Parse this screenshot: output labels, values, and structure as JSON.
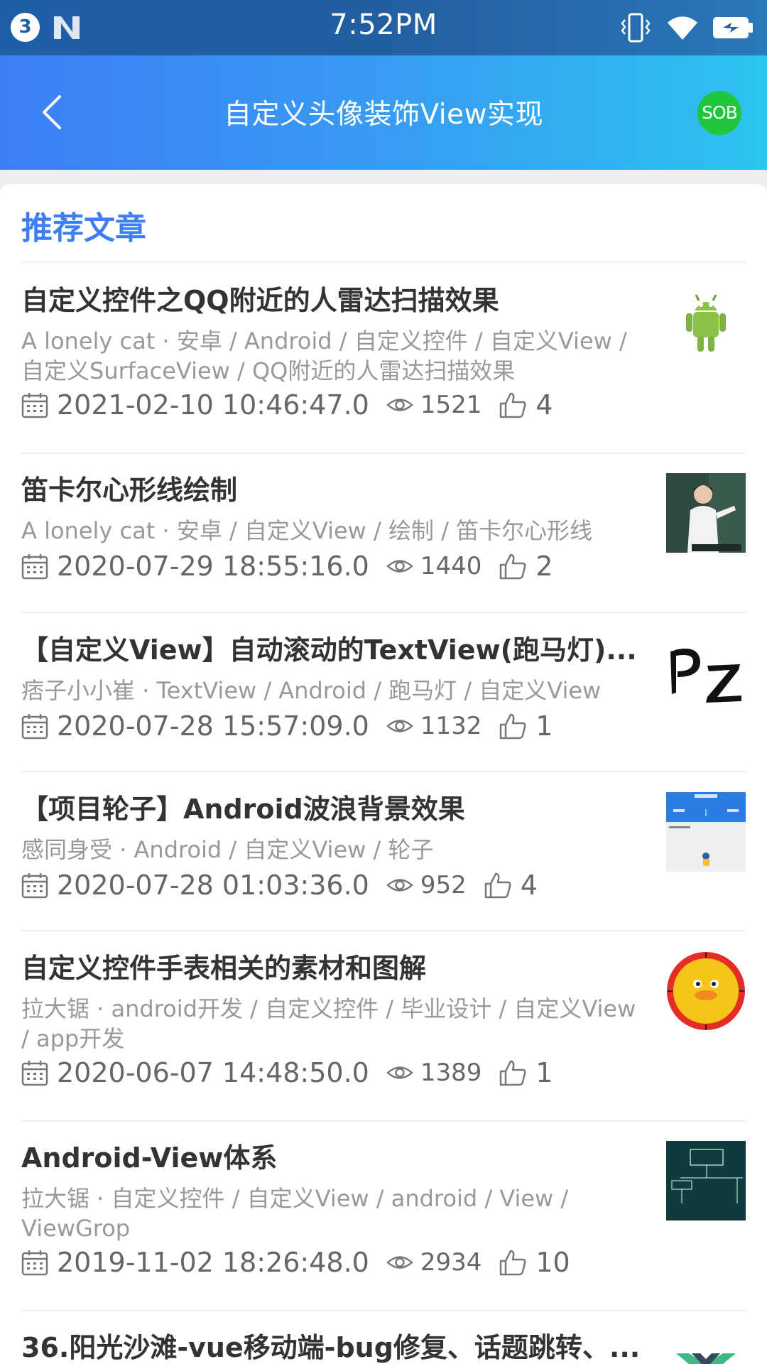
{
  "status_bar": {
    "notification_count": "3",
    "time": "7:52PM",
    "icons": [
      "n-icon",
      "vibrate-icon",
      "wifi-icon",
      "battery-charging-icon"
    ]
  },
  "app_bar": {
    "title": "自定义头像装饰View实现",
    "avatar_text": "SOB",
    "avatar_color": "#20c63c"
  },
  "section": {
    "title": "推荐文章"
  },
  "articles": [
    {
      "title": "自定义控件之QQ附近的人雷达扫描效果",
      "meta": "A lonely cat · 安卓 / Android / 自定义控件 / 自定义View / 自定义SurfaceView / QQ附近的人雷达扫描效果",
      "date": "2021-02-10 10:46:47.0",
      "views": "1521",
      "likes": "4",
      "thumb": "android-robot"
    },
    {
      "title": "笛卡尔心形线绘制",
      "meta": "A lonely cat · 安卓 / 自定义View / 绘制 / 笛卡尔心形线",
      "date": "2020-07-29 18:55:16.0",
      "views": "1440",
      "likes": "2",
      "thumb": "person-photo"
    },
    {
      "title": "【自定义View】自动滚动的TextView(跑马灯)...",
      "meta": "痞子小小崔 · TextView / Android / 跑马灯 / 自定义View",
      "date": "2020-07-28 15:57:09.0",
      "views": "1132",
      "likes": "1",
      "thumb": "pz-logo"
    },
    {
      "title": "【项目轮子】Android波浪背景效果",
      "meta": "感同身受 · Android / 自定义View / 轮子",
      "date": "2020-07-28 01:03:36.0",
      "views": "952",
      "likes": "4",
      "thumb": "app-screenshot"
    },
    {
      "title": "自定义控件手表相关的素材和图解",
      "meta": "拉大锯 · android开发 / 自定义控件 / 毕业设计 / 自定义View / app开发",
      "date": "2020-06-07 14:48:50.0",
      "views": "1389",
      "likes": "1",
      "thumb": "duck-clock"
    },
    {
      "title": "Android-View体系",
      "meta": "拉大锯 · 自定义控件 / 自定义View / android / View / ViewGrop",
      "date": "2019-11-02 18:26:48.0",
      "views": "2934",
      "likes": "10",
      "thumb": "view-diagram"
    },
    {
      "title": "36.阳光沙滩-vue移动端-bug修复、话题跳转、...",
      "thumb": "vue-logo"
    }
  ]
}
